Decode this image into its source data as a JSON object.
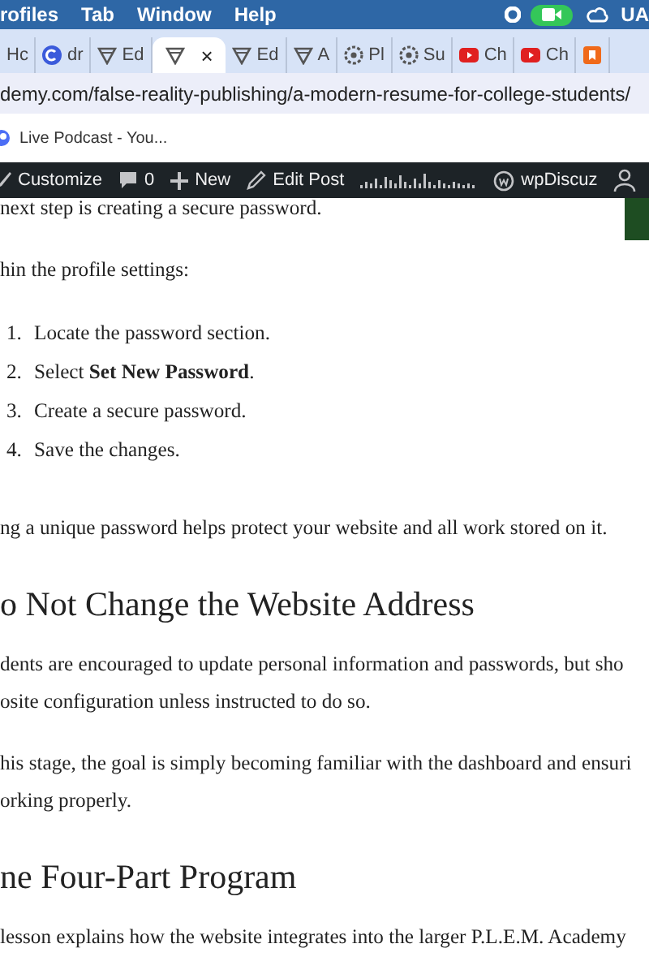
{
  "menu_bar": {
    "items": [
      "rofiles",
      "Tab",
      "Window",
      "Help"
    ],
    "user": "UA"
  },
  "tabs": [
    {
      "label": "Hc",
      "kind": "none",
      "selected": false
    },
    {
      "label": "dr",
      "kind": "c-logo",
      "selected": false
    },
    {
      "label": "Ed",
      "kind": "funnel",
      "selected": false
    },
    {
      "close": "×",
      "kind": "funnel",
      "selected": true
    },
    {
      "label": "Ed",
      "kind": "funnel",
      "selected": false
    },
    {
      "label": "A",
      "kind": "funnel",
      "selected": false
    },
    {
      "label": "Pl",
      "kind": "gear",
      "selected": false
    },
    {
      "label": "Su",
      "kind": "gear",
      "selected": false
    },
    {
      "label": "Ch",
      "kind": "video",
      "selected": false
    },
    {
      "label": "Ch",
      "kind": "video",
      "selected": false
    },
    {
      "kind": "bookmark",
      "selected": false
    }
  ],
  "address_bar": {
    "url": "demy.com/false-reality-publishing/a-modern-resume-for-college-students/"
  },
  "bookmarks": [
    {
      "label": "Live Podcast - You..."
    }
  ],
  "admin_bar": {
    "items": [
      {
        "kind": "customize",
        "label": "Customize"
      },
      {
        "kind": "comments",
        "label": "0"
      },
      {
        "kind": "new",
        "label": "New"
      },
      {
        "kind": "edit",
        "label": "Edit Post"
      },
      {
        "kind": "stats"
      },
      {
        "kind": "wpdiscuz",
        "label": "wpDiscuz"
      },
      {
        "kind": "user"
      }
    ]
  },
  "article": {
    "blocks": [
      {
        "kind": "paragraph",
        "lines": [
          "next step is creating a secure password."
        ]
      },
      {
        "kind": "paragraph",
        "lines": [
          "hin the profile settings:"
        ]
      },
      {
        "kind": "list",
        "items": [
          {
            "number": "1.",
            "text": "Locate the password section."
          },
          {
            "number": "2.",
            "text": "Select **Set New Password**."
          },
          {
            "number": "3.",
            "text": "Create a secure password."
          },
          {
            "number": "4.",
            "text": "Save the changes."
          }
        ]
      },
      {
        "kind": "paragraph",
        "lines": [
          "ng a unique password helps protect your website and all work stored on it."
        ]
      },
      {
        "kind": "heading",
        "text": "o Not Change the Website Address"
      },
      {
        "kind": "paragraph",
        "lines": [
          "dents are encouraged to update personal information and passwords, but sho",
          "osite configuration unless instructed to do so."
        ]
      },
      {
        "kind": "paragraph",
        "lines": [
          "his stage, the goal is simply becoming familiar with the dashboard and ensuri",
          "orking properly."
        ]
      },
      {
        "kind": "heading",
        "text": "ne Four-Part Program"
      },
      {
        "kind": "paragraph",
        "lines": [
          "lesson explains how the website integrates into the larger P.L.E.M. Academy"
        ]
      }
    ]
  }
}
